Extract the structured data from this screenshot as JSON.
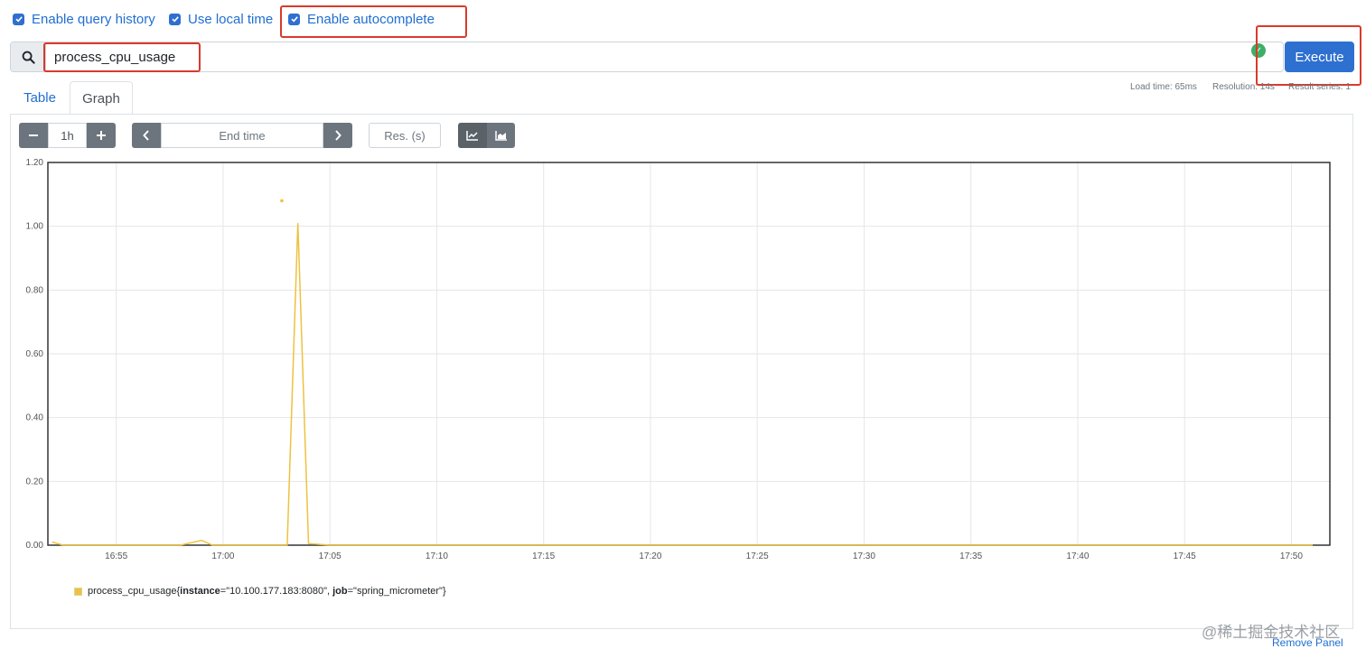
{
  "options": {
    "query_history": {
      "label": "Enable query history",
      "checked": true
    },
    "local_time": {
      "label": "Use local time",
      "checked": true
    },
    "autocomplete": {
      "label": "Enable autocomplete",
      "checked": true
    }
  },
  "query": {
    "value": "process_cpu_usage"
  },
  "execute": {
    "label": "Execute"
  },
  "status_icon": "status-ok-icon",
  "tabs": [
    {
      "label": "Table",
      "active": false
    },
    {
      "label": "Graph",
      "active": true
    }
  ],
  "stats": {
    "load_time": "Load time: 65ms",
    "resolution": "Resolution: 14s",
    "result_series": "Result series: 1"
  },
  "controls": {
    "range_value": "1h",
    "end_time_placeholder": "End time",
    "res_placeholder": "Res. (s)"
  },
  "icons": {
    "search": "search-icon",
    "minus": "minus-icon",
    "plus": "plus-icon",
    "prev": "chevron-left-icon",
    "next": "chevron-right-icon",
    "line_mode": "line-chart-icon",
    "stacked_mode": "stacked-area-chart-icon"
  },
  "colors": {
    "accent": "#2e70d0",
    "series": "#edc240",
    "highlight": "#d93a2b"
  },
  "chart_data": {
    "type": "line",
    "ylim": [
      0,
      1.2
    ],
    "y_ticks": [
      "1.20",
      "1.00",
      "0.80",
      "0.60",
      "0.40",
      "0.20",
      "0.00"
    ],
    "x_ticks": [
      "16:55",
      "17:00",
      "17:05",
      "17:10",
      "17:15",
      "17:20",
      "17:25",
      "17:30",
      "17:35",
      "17:40",
      "17:45",
      "17:50"
    ],
    "grid": true,
    "series": [
      {
        "name": "process_cpu_usage{instance=\"10.100.177.183:8080\", job=\"spring_micrometer\"}",
        "points": [
          [
            "16:52",
            0.01
          ],
          [
            "16:52:30",
            0.0
          ],
          [
            "16:53",
            0.0
          ],
          [
            "16:56",
            0.0
          ],
          [
            "16:58",
            0.0
          ],
          [
            "16:59",
            0.015
          ],
          [
            "16:59:30",
            0.0
          ],
          [
            "17:03",
            0.0
          ],
          [
            "17:03:30",
            1.01
          ],
          [
            "17:04",
            0.005
          ],
          [
            "17:05",
            0.0
          ],
          [
            "17:15",
            0.0
          ],
          [
            "17:18",
            0.0
          ],
          [
            "17:20",
            0.0
          ],
          [
            "17:25",
            0.0
          ],
          [
            "17:30",
            0.0
          ],
          [
            "17:40",
            0.0
          ],
          [
            "17:50",
            0.0
          ],
          [
            "17:51",
            0.0
          ]
        ],
        "isolated_points": [
          [
            "17:02:45",
            1.08
          ]
        ]
      }
    ],
    "legend": {
      "metric": "process_cpu_usage{",
      "instance_key": "instance",
      "instance_val": "=\"10.100.177.183:8080\", ",
      "job_key": "job",
      "job_val": "=\"spring_micrometer\"}"
    }
  },
  "footer": {
    "remove_panel": "Remove Panel",
    "watermark": "@稀土掘金技术社区"
  }
}
